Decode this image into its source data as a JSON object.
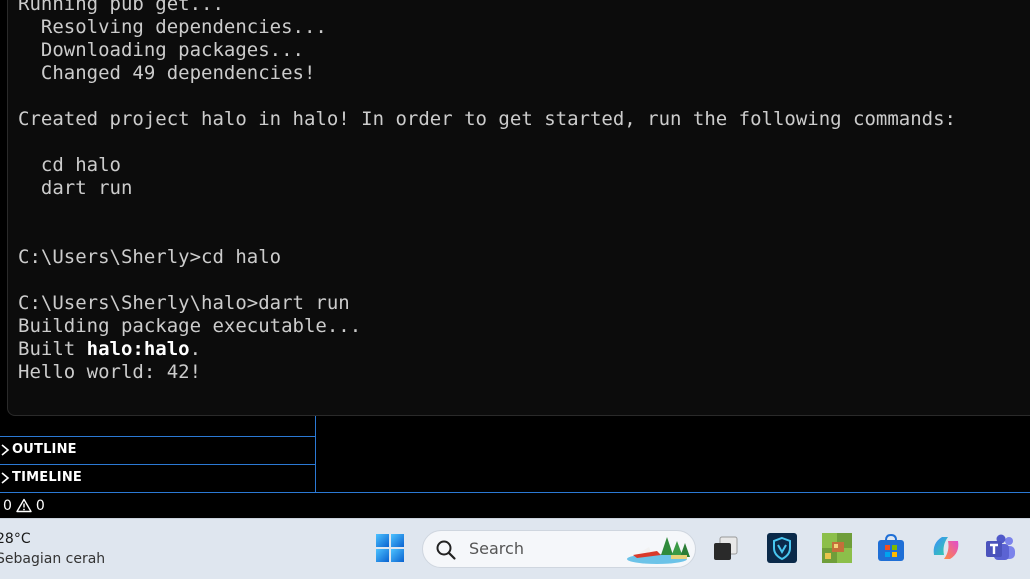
{
  "terminal": {
    "lines": [
      "Running pub get...",
      "  Resolving dependencies...",
      "  Downloading packages...",
      "  Changed 49 dependencies!",
      "",
      "Created project halo in halo! In order to get started, run the following commands:",
      "",
      "  cd halo",
      "  dart run",
      "",
      "",
      "C:\\Users\\Sherly>cd halo",
      "",
      "C:\\Users\\Sherly\\halo>dart run",
      "Building package executable...",
      "Built ",
      "Hello world: 42!"
    ],
    "built_prefix": "Built ",
    "built_target": "halo:halo",
    "built_suffix": "."
  },
  "sidebar": {
    "sections": [
      {
        "label": "OUTLINE"
      },
      {
        "label": "TIMELINE"
      }
    ]
  },
  "status_bar": {
    "errors": "0",
    "warnings": "0"
  },
  "taskbar": {
    "weather": {
      "temperature": "28°C",
      "condition": "Sebagian cerah"
    },
    "search_placeholder": "Search",
    "icons": [
      "windows-start-icon",
      "task-view-icon",
      "app-shield-icon",
      "game-app-icon",
      "microsoft-store-icon",
      "copilot-icon",
      "teams-icon"
    ]
  },
  "colors": {
    "terminal_bg": "#0c0c0c",
    "terminal_text": "#cccccc",
    "accent_border": "#2b79d4",
    "taskbar_bg": "#dfe6ef"
  }
}
